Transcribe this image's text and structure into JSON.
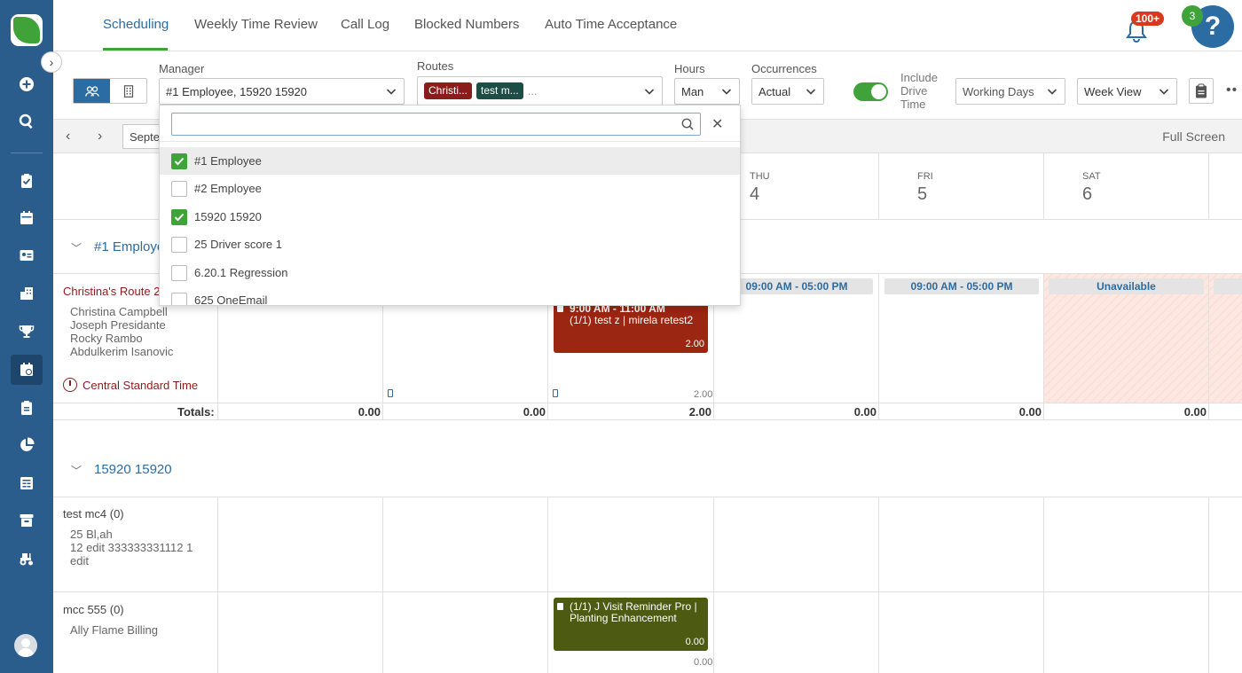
{
  "tabs": [
    {
      "label": "Scheduling",
      "active": true
    },
    {
      "label": "Weekly Time Review"
    },
    {
      "label": "Call Log"
    },
    {
      "label": "Blocked Numbers"
    },
    {
      "label": "Auto Time Acceptance"
    }
  ],
  "notifications": {
    "badge": "100+"
  },
  "help": {
    "badge": "3",
    "glyph": "?"
  },
  "filters": {
    "manager": {
      "label": "Manager",
      "value": "#1 Employee, 15920 15920"
    },
    "routes": {
      "label": "Routes",
      "chips": [
        "Christi...",
        "test m..."
      ],
      "more": "..."
    },
    "hours": {
      "label": "Hours",
      "value": "Man"
    },
    "occurrences": {
      "label": "Occurrences",
      "value": "Actual"
    },
    "drive_time": {
      "label_lines": [
        "Include",
        "Drive",
        "Time"
      ],
      "enabled": true
    },
    "days": {
      "value": "Working Days"
    },
    "view": {
      "value": "Week View"
    }
  },
  "week_nav": {
    "date_value": "Septe",
    "full_screen": "Full Screen"
  },
  "days": [
    {
      "dow": "THU",
      "num": "4"
    },
    {
      "dow": "FRI",
      "num": "5"
    },
    {
      "dow": "SAT",
      "num": "6"
    }
  ],
  "group1": {
    "title": "#1 Employee",
    "route_name": "Christina's Route 2",
    "members": [
      "Christina Campbell",
      "Joseph Presidante",
      "Rocky Rambo",
      "Abdulkerim Isanovic"
    ],
    "timezone": "Central Standard Time",
    "hours_pills": [
      "09:00 AM - 05:00 PM",
      "09:00 AM - 05:00 PM",
      "Unavailable"
    ],
    "event": {
      "time": "9:00 AM - 11:00 AM",
      "title": "(1/1) test z | mirela retest2",
      "hours": "2.00"
    },
    "cell_hours": "2.00",
    "totals_label": "Totals:",
    "totals": [
      "0.00",
      "0.00",
      "2.00",
      "0.00",
      "0.00",
      "0.00"
    ]
  },
  "group2": {
    "title": "15920 15920",
    "rows": [
      {
        "route_name": "test mc4 (0)",
        "members": [
          "25 Bl,ah",
          "12 edit 333333331112 1",
          "edit"
        ]
      },
      {
        "route_name": "mcc 555 (0)",
        "members": [
          "Ally Flame Billing"
        ],
        "event": {
          "title_lines": [
            "(1/1) J Visit Reminder Pro |",
            "Planting Enhancement"
          ],
          "hours": "0.00"
        },
        "cell_hours": "0.00"
      }
    ]
  },
  "dropdown": {
    "search_placeholder": "",
    "options": [
      {
        "label": "#1 Employee",
        "checked": true,
        "highlighted": true
      },
      {
        "label": "#2 Employee",
        "checked": false
      },
      {
        "label": "15920 15920",
        "checked": true
      },
      {
        "label": "25 Driver score 1",
        "checked": false
      },
      {
        "label": "6.20.1 Regression",
        "checked": false
      },
      {
        "label": "625 OneEmail",
        "checked": false
      }
    ]
  },
  "colors": {
    "brand_blue": "#2b6ca3",
    "sidebar": "#2b5d8c",
    "green": "#3fa33a",
    "event_red": "#9b2612",
    "event_olive": "#4d5a12",
    "chip_red": "#8b1c1c",
    "chip_teal": "#1d4d45"
  }
}
